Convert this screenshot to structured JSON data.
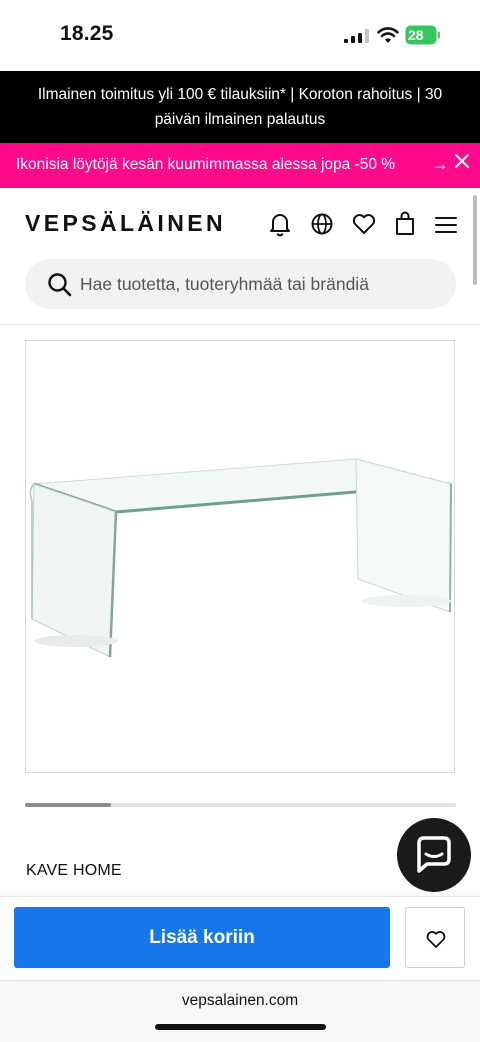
{
  "status_bar": {
    "time": "18.25",
    "battery": "28"
  },
  "promo": {
    "shipping_text": "Ilmainen toimitus yli 100 € tilauksiin* | Koroton rahoitus | 30 päivän ilmainen palautus",
    "sale_text": "Ikonisia löytöjä kesän kuumimmassa alessa jopa -50 %",
    "sale_arrow": "→"
  },
  "header": {
    "logo": "VEPSÄLÄINEN",
    "icons": [
      "bell-icon",
      "globe-icon",
      "heart-icon",
      "shopping-bag-icon",
      "menu-icon"
    ]
  },
  "search": {
    "placeholder": "Hae tuotetta, tuoteryhmää tai brändiä",
    "value": ""
  },
  "product": {
    "brand": "KAVE HOME",
    "image": "glass coffee table",
    "gallery_progress": 0.2
  },
  "actions": {
    "add_to_cart": "Lisää koriin"
  },
  "browser": {
    "url": "vepsalainen.com"
  },
  "colors": {
    "accent": "#1577ea",
    "promo_pink": "#ff0a8c",
    "promo_black": "#000000"
  }
}
